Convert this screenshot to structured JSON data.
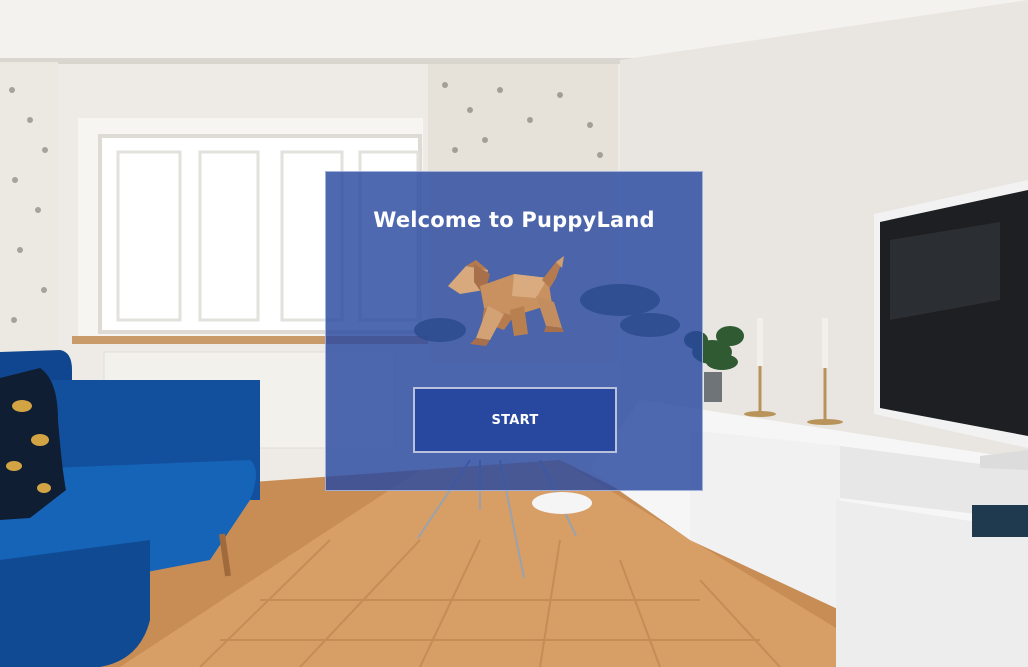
{
  "app": {
    "title": "Welcome to PuppyLand",
    "start_label": "START"
  },
  "mascot": {
    "icon": "origami-dog-icon",
    "colors": {
      "light": "#d7a679",
      "mid": "#c48d5f",
      "dark": "#a8704a"
    }
  },
  "background": {
    "description_icon": "living-room-background",
    "panel_color": "#2848a0"
  }
}
